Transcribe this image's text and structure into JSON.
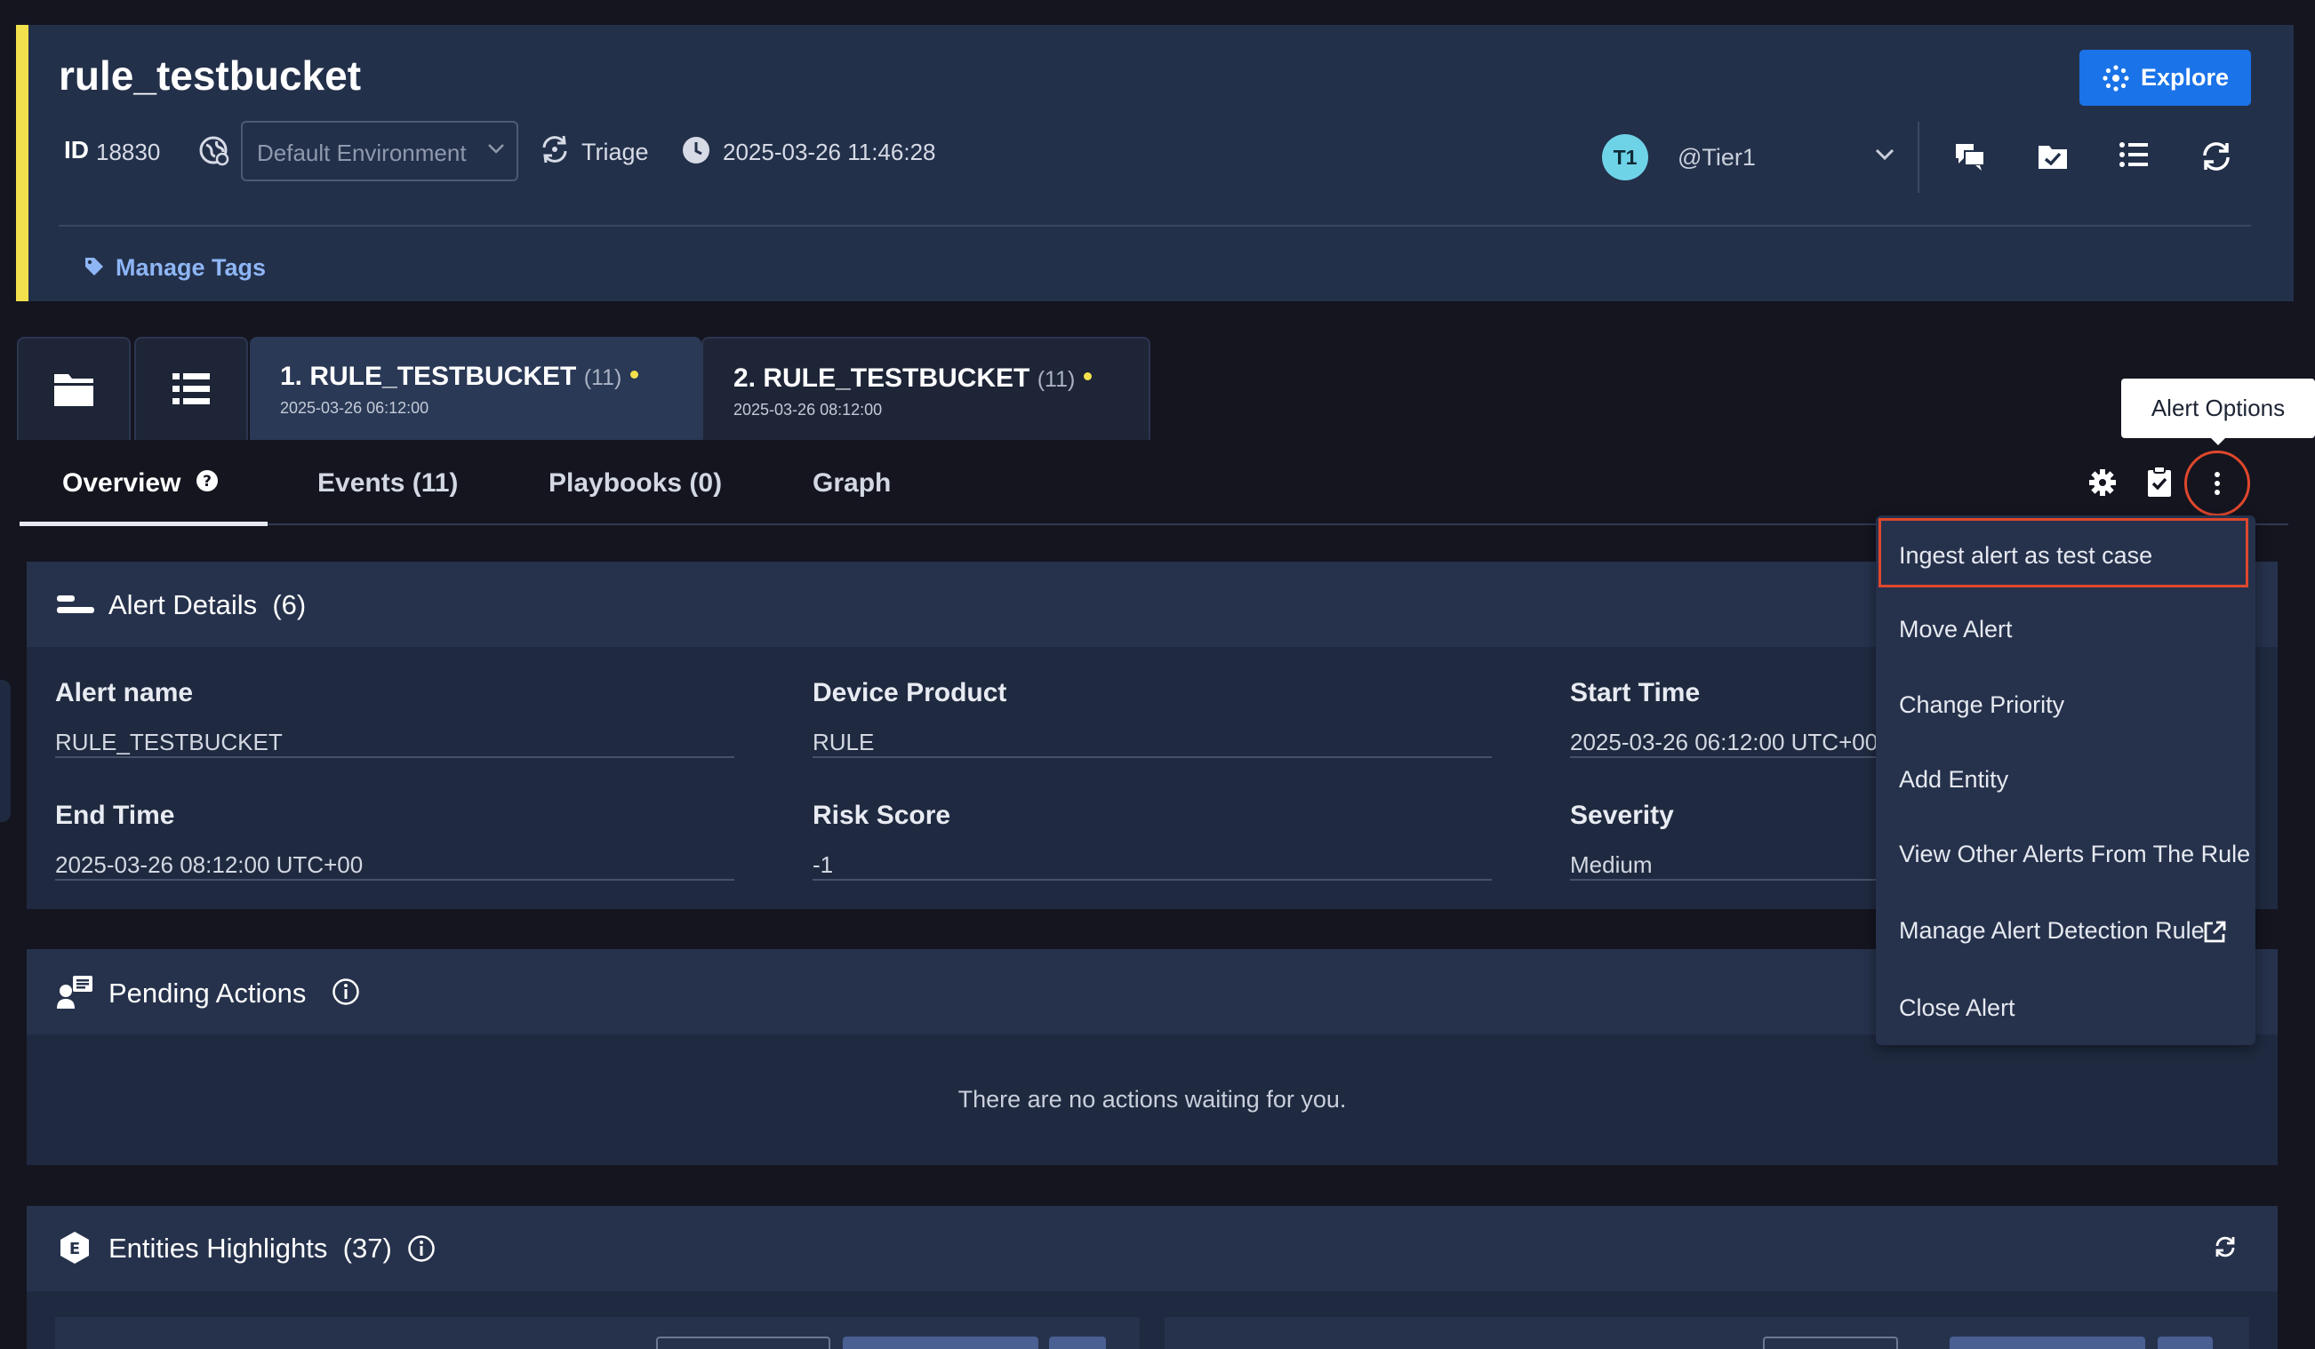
{
  "header": {
    "title": "rule_testbucket",
    "id_label": "ID",
    "id_value": "18830",
    "environment": "Default Environment",
    "stage": "Triage",
    "datetime": "2025-03-26 11:46:28",
    "explore_label": "Explore",
    "assignee_initials": "T1",
    "assignee": "@Tier1",
    "manage_tags": "Manage Tags"
  },
  "alert_tabs": [
    {
      "title": "1. RULE_TESTBUCKET",
      "count": "(11)",
      "date": "2025-03-26 06:12:00"
    },
    {
      "title": "2. RULE_TESTBUCKET",
      "count": "(11)",
      "date": "2025-03-26 08:12:00"
    }
  ],
  "nav_tabs": {
    "overview": "Overview",
    "events": "Events (11)",
    "playbooks": "Playbooks (0)",
    "graph": "Graph"
  },
  "tooltip": "Alert Options",
  "alert_details": {
    "title": "Alert Details",
    "count": "(6)",
    "fields": [
      {
        "label": "Alert name",
        "value": "RULE_TESTBUCKET"
      },
      {
        "label": "Device Product",
        "value": "RULE"
      },
      {
        "label": "Start Time",
        "value": "2025-03-26 06:12:00 UTC+00"
      },
      {
        "label": "End Time",
        "value": "2025-03-26 08:12:00 UTC+00"
      },
      {
        "label": "Risk Score",
        "value": "-1"
      },
      {
        "label": "Severity",
        "value": "Medium"
      }
    ]
  },
  "pending_actions": {
    "title": "Pending Actions",
    "empty_text": "There are no actions waiting for you."
  },
  "entities": {
    "title": "Entities Highlights",
    "count": "(37)"
  },
  "menu": {
    "items": [
      "Ingest alert as test case",
      "Move Alert",
      "Change Priority",
      "Add Entity",
      "View Other Alerts From The Rule",
      "Manage Alert Detection Rule",
      "Close Alert"
    ]
  },
  "colors": {
    "accent_yellow": "#f2e14c",
    "primary_blue": "#1a73e8",
    "highlight_red": "#e0472d",
    "panel": "#1f2a40"
  },
  "icons": [
    "folder-icon",
    "list-icon",
    "gear-icon",
    "clipboard-check-icon",
    "kebab-icon",
    "refresh-icon",
    "clock-icon",
    "tag-icon",
    "info-icon",
    "external-link-icon"
  ]
}
